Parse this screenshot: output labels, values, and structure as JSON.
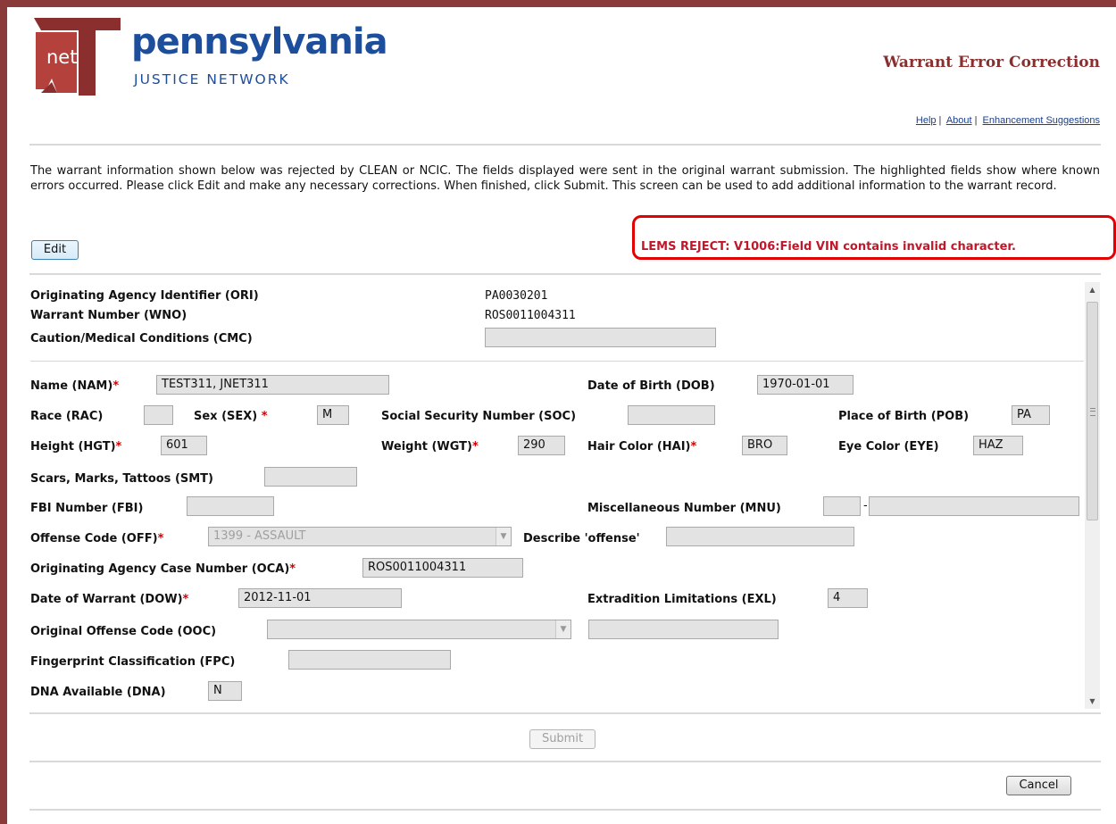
{
  "header": {
    "logo_mark": "net",
    "logo_name": "pennsylvania",
    "logo_sub": "JUSTICE NETWORK",
    "page_title": "Warrant Error Correction",
    "links": [
      "Help",
      "About",
      "Enhancement Suggestions"
    ]
  },
  "intro": "The warrant information shown below was rejected by CLEAN or NCIC. The fields displayed were sent in the original warrant submission. The highlighted fields show where known errors occurred. Please click Edit and make any necessary corrections. When finished, click Submit. This screen can be used to add additional information to the warrant record.",
  "buttons": {
    "edit": "Edit",
    "submit": "Submit",
    "cancel": "Cancel"
  },
  "error_message": "LEMS REJECT: V1006:Field VIN contains invalid character.",
  "summary": {
    "ori_label": "Originating Agency Identifier (ORI)",
    "ori_value": "PA0030201",
    "wno_label": "Warrant Number (WNO)",
    "wno_value": "ROS0011004311",
    "cmc_label": "Caution/Medical Conditions (CMC)",
    "cmc_value": ""
  },
  "fields": {
    "nam": {
      "label": "Name (NAM)",
      "value": "TEST311, JNET311"
    },
    "dob": {
      "label": "Date of Birth (DOB)",
      "value": "1970-01-01"
    },
    "rac": {
      "label": "Race (RAC)",
      "value": ""
    },
    "sex": {
      "label": "Sex (SEX)",
      "value": "M"
    },
    "soc": {
      "label": "Social Security Number (SOC)",
      "value": ""
    },
    "pob": {
      "label": "Place of Birth (POB)",
      "value": "PA"
    },
    "hgt": {
      "label": "Height (HGT)",
      "value": "601"
    },
    "wgt": {
      "label": "Weight (WGT)",
      "value": "290"
    },
    "hai": {
      "label": "Hair Color (HAI)",
      "value": "BRO"
    },
    "eye": {
      "label": "Eye Color (EYE)",
      "value": "HAZ"
    },
    "smt": {
      "label": "Scars, Marks, Tattoos (SMT)",
      "value": ""
    },
    "fbi": {
      "label": "FBI Number (FBI)",
      "value": ""
    },
    "mnu": {
      "label": "Miscellaneous Number (MNU)",
      "value_a": "",
      "value_b": "",
      "separator": "-"
    },
    "off": {
      "label": "Offense Code (OFF)",
      "value": "1399 - ASSAULT"
    },
    "off_desc": {
      "label": "Describe 'offense'",
      "value": ""
    },
    "oca": {
      "label": "Originating Agency Case Number (OCA)",
      "value": "ROS0011004311"
    },
    "dow": {
      "label": "Date of Warrant (DOW)",
      "value": "2012-11-01"
    },
    "exl": {
      "label": "Extradition Limitations (EXL)",
      "value": "4"
    },
    "ooc": {
      "label": "Original Offense Code (OOC)",
      "value": "",
      "desc": ""
    },
    "fpc": {
      "label": "Fingerprint Classification (FPC)",
      "value": ""
    },
    "dna": {
      "label": "DNA Available (DNA)",
      "value": "N"
    }
  },
  "required_marker": "*",
  "colors": {
    "frame": "#8b3a3a",
    "logo_blue": "#1d4e9c",
    "title": "#8b2e2e",
    "error": "#e20000"
  },
  "icons": [
    "logo-mark-icon",
    "chevron-down-icon",
    "scroll-up-icon",
    "scroll-down-icon"
  ]
}
